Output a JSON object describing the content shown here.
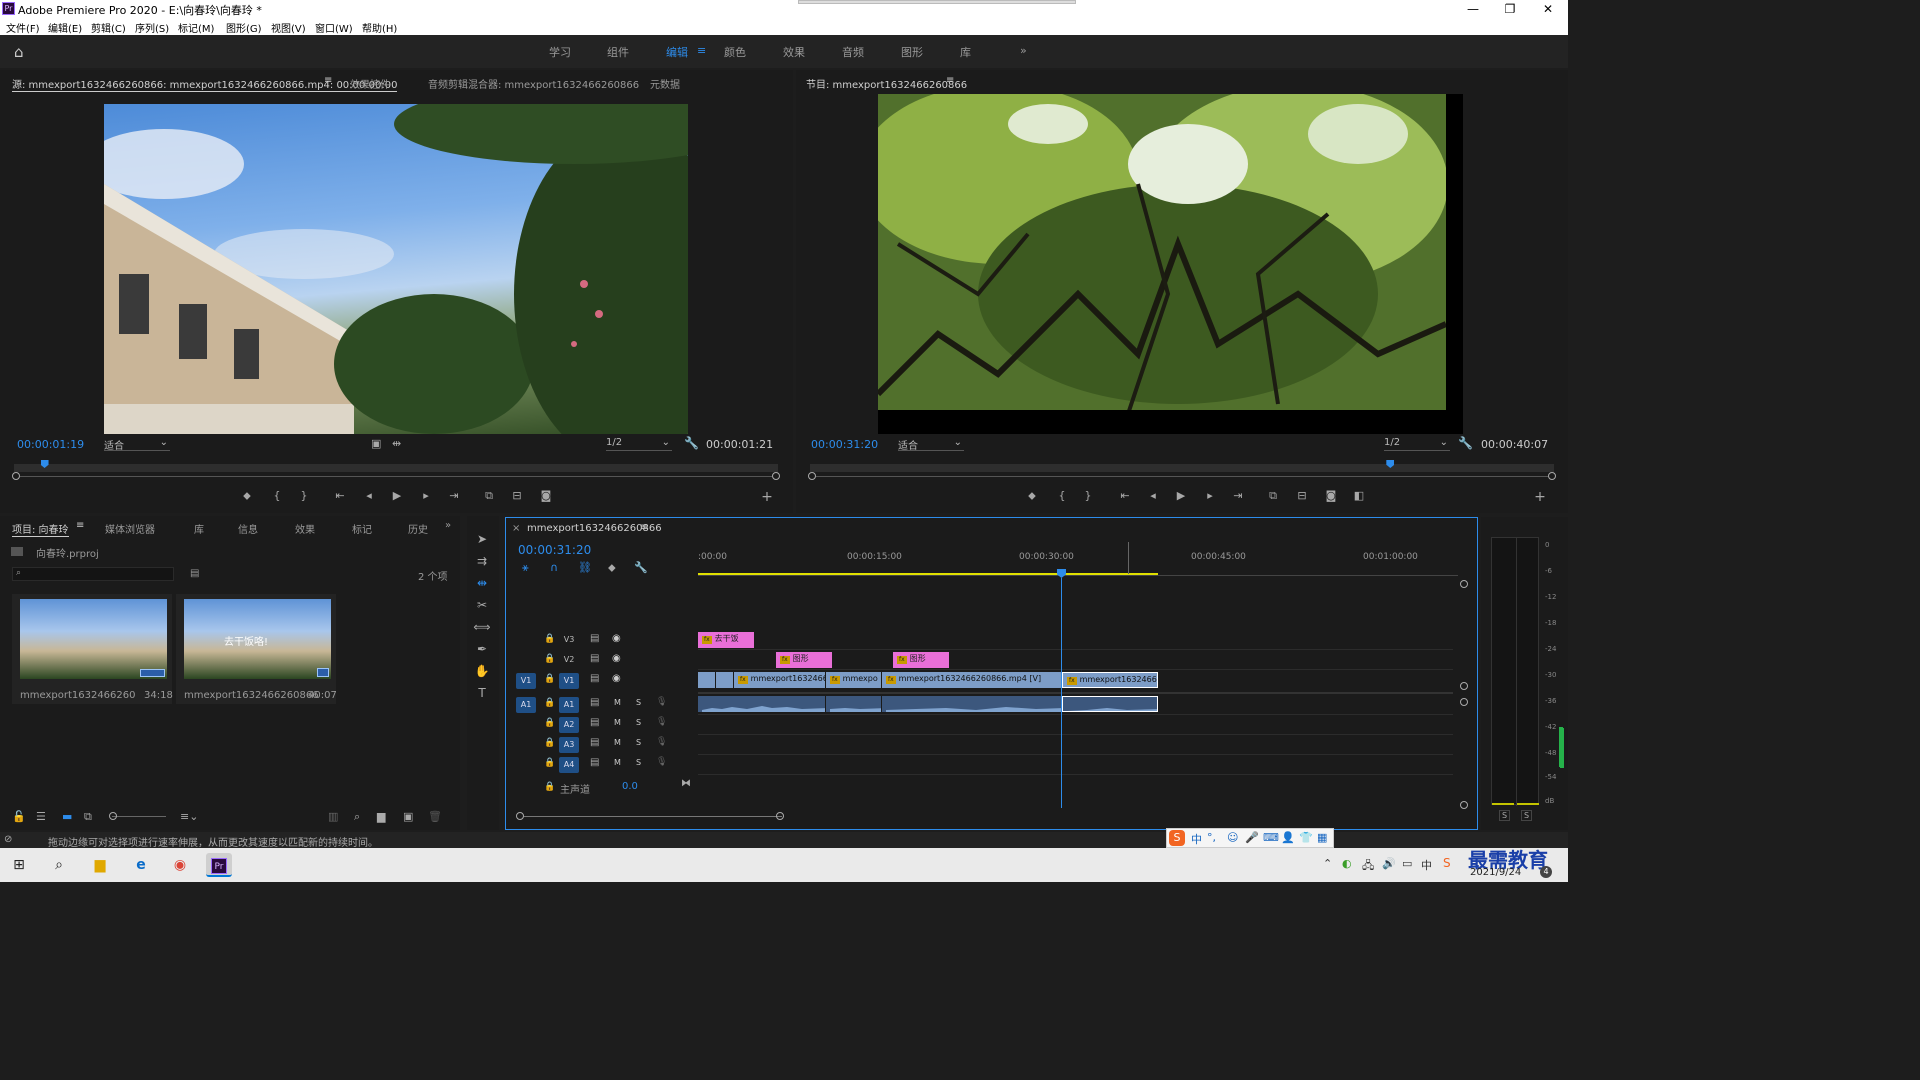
{
  "window": {
    "title": "Adobe Premiere Pro 2020 - E:\\向春玲\\向春玲 *",
    "app_icon": "Pr"
  },
  "menu": [
    "文件(F)",
    "编辑(E)",
    "剪辑(C)",
    "序列(S)",
    "标记(M)",
    "图形(G)",
    "视图(V)",
    "窗口(W)",
    "帮助(H)"
  ],
  "workspaces": [
    "学习",
    "组件",
    "编辑",
    "颜色",
    "效果",
    "音频",
    "图形",
    "库"
  ],
  "workspace_active": "编辑",
  "source": {
    "tab": "源: mmexport1632466260866: mmexport1632466260866.mp4: 00:00:00:00",
    "tab_effect": "效果控件",
    "tab_mixer": "音频剪辑混合器: mmexport1632466260866",
    "tab_meta": "元数据",
    "timecode": "00:00:01:19",
    "zoom": "适合",
    "res": "1/2",
    "duration": "00:00:01:21",
    "playhead_fraction": 0.04
  },
  "program": {
    "tab": "节目: mmexport1632466260866",
    "timecode": "00:00:31:20",
    "zoom": "适合",
    "res": "1/2",
    "duration": "00:00:40:07",
    "playhead_fraction": 0.78
  },
  "project": {
    "tabs": [
      "项目: 向春玲",
      "媒体浏览器",
      "库",
      "信息",
      "效果",
      "标记",
      "历史"
    ],
    "file": "向春玲.prproj",
    "count": "2 个项",
    "items": [
      {
        "name": "mmexport1632466260866...",
        "duration": "34:18"
      },
      {
        "name": "mmexport1632466260866",
        "duration": "40:07",
        "overlay": "去干饭咯!"
      }
    ]
  },
  "timeline": {
    "tab": "mmexport1632466260866",
    "timecode": "00:00:31:20",
    "ruler": [
      ":00:00",
      "00:00:15:00",
      "00:00:30:00",
      "00:00:45:00",
      "00:01:00:00"
    ],
    "tracks_video": [
      "V3",
      "V2",
      "V1"
    ],
    "tracks_audio": [
      "A1",
      "A2",
      "A3",
      "A4"
    ],
    "master": "主声道",
    "master_value": "0.0",
    "clips": {
      "v3_title": "去干饭",
      "v2_a": "图形",
      "v2_b": "图形",
      "v1_a": "mmexport1632466",
      "v1_b": "mmexpo",
      "v1_c": "mmexport1632466260866.mp4 [V]",
      "v1_d": "mmexport16324662"
    }
  },
  "meter": {
    "labels": [
      "0",
      "-6",
      "-12",
      "-18",
      "-24",
      "-30",
      "-36",
      "-42",
      "-48",
      "-54",
      "dB"
    ],
    "solo": [
      "S",
      "S"
    ]
  },
  "status_text": "拖动边缘可对选择项进行速率伸展，从而更改其速度以匹配新的持续时间。",
  "ime": [
    "中",
    "°,"
  ],
  "watermark": "最需教育",
  "clock": {
    "date": "2021/9/24",
    "badge": "4"
  },
  "colors": {
    "accent": "#2d8ceb",
    "v3clip": "#e96fd8",
    "v1clip": "#7d9dc7",
    "audio": "#3c577d",
    "playhead_bar": "#e0e000"
  }
}
